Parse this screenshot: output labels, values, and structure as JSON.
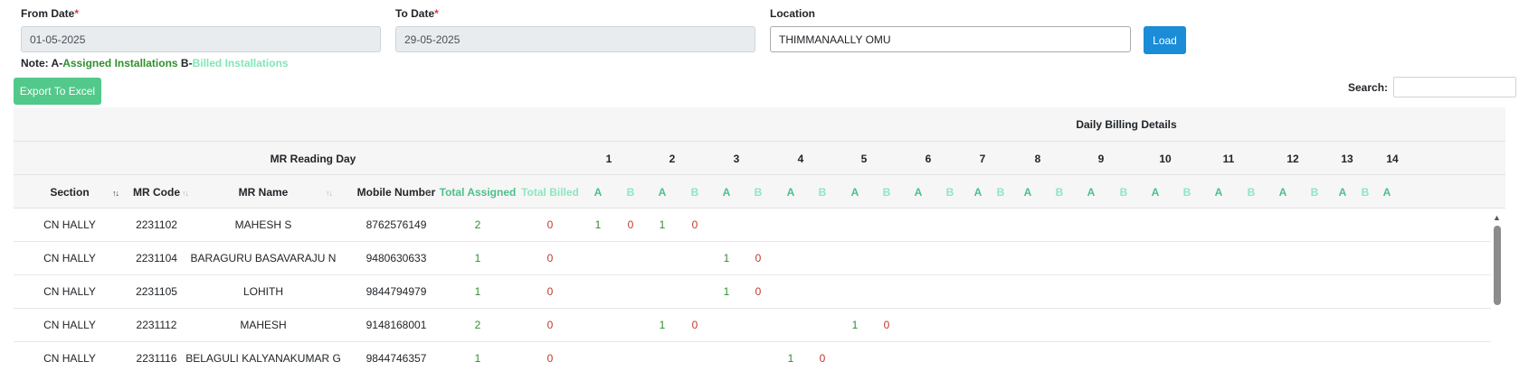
{
  "filters": {
    "from_date": {
      "label": "From Date",
      "required": "*",
      "value": "01-05-2025"
    },
    "to_date": {
      "label": "To Date",
      "required": "*",
      "value": "29-05-2025"
    },
    "location": {
      "label": "Location",
      "value": "THIMMANAALLY OMU"
    },
    "load_label": "Load"
  },
  "note": {
    "prefix": "Note: A-",
    "a_text": "Assigned Installations",
    "mid": " B-",
    "b_text": "Billed Installations"
  },
  "toolbar": {
    "export_label": "Export To Excel",
    "search_label": "Search:"
  },
  "table": {
    "group_header": "Daily Billing Details",
    "mr_reading_day_label": "MR Reading Day",
    "days": [
      "1",
      "2",
      "3",
      "4",
      "5",
      "6",
      "7",
      "8",
      "9",
      "10",
      "11",
      "12",
      "13",
      "14"
    ],
    "columns": [
      "Section",
      "MR Code",
      "MR Name",
      "Mobile Number",
      "Total Assigned",
      "Total Billed"
    ],
    "a_label": "A",
    "b_label": "B",
    "rows": [
      {
        "section": "CN HALLY",
        "mr_code": "2231102",
        "mr_name": "MAHESH S",
        "mobile": "8762576149",
        "total_assigned": "2",
        "total_billed": "0",
        "cells": [
          {
            "day": 1,
            "a": "1",
            "b": "0"
          },
          {
            "day": 2,
            "a": "1",
            "b": "0"
          }
        ]
      },
      {
        "section": "CN HALLY",
        "mr_code": "2231104",
        "mr_name": "BARAGURU BASAVARAJU N",
        "mobile": "9480630633",
        "total_assigned": "1",
        "total_billed": "0",
        "cells": [
          {
            "day": 3,
            "a": "1",
            "b": "0"
          }
        ]
      },
      {
        "section": "CN HALLY",
        "mr_code": "2231105",
        "mr_name": "LOHITH",
        "mobile": "9844794979",
        "total_assigned": "1",
        "total_billed": "0",
        "cells": [
          {
            "day": 3,
            "a": "1",
            "b": "0"
          }
        ]
      },
      {
        "section": "CN HALLY",
        "mr_code": "2231112",
        "mr_name": "MAHESH",
        "mobile": "9148168001",
        "total_assigned": "2",
        "total_billed": "0",
        "cells": [
          {
            "day": 2,
            "a": "1",
            "b": "0"
          },
          {
            "day": 5,
            "a": "1",
            "b": "0"
          }
        ]
      },
      {
        "section": "CN HALLY",
        "mr_code": "2231116",
        "mr_name": "BELAGULI KALYANAKUMAR G",
        "mobile": "9844746357",
        "total_assigned": "1",
        "total_billed": "0",
        "cells": [
          {
            "day": 4,
            "a": "1",
            "b": "0"
          }
        ]
      }
    ]
  },
  "colors": {
    "accent": "#1a8cd8",
    "export": "#52c88a",
    "assigned": "#2f8f2f",
    "billed": "#7ee6b8"
  }
}
